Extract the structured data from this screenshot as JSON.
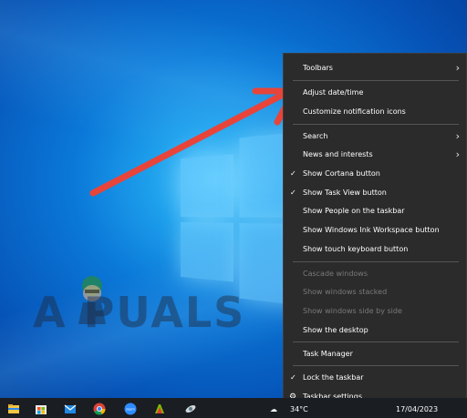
{
  "watermark": "A  PUALS",
  "context_menu": {
    "items": [
      {
        "label": "Toolbars",
        "submenu": true
      },
      {
        "label": "Adjust date/time"
      },
      {
        "label": "Customize notification icons"
      },
      {
        "label": "Search",
        "submenu": true
      },
      {
        "label": "News and interests",
        "submenu": true
      },
      {
        "label": "Show Cortana button",
        "checked": true
      },
      {
        "label": "Show Task View button",
        "checked": true
      },
      {
        "label": "Show People on the taskbar"
      },
      {
        "label": "Show Windows Ink Workspace button"
      },
      {
        "label": "Show touch keyboard button"
      },
      {
        "label": "Cascade windows",
        "disabled": true
      },
      {
        "label": "Show windows stacked",
        "disabled": true
      },
      {
        "label": "Show windows side by side",
        "disabled": true
      },
      {
        "label": "Show the desktop"
      },
      {
        "label": "Task Manager"
      },
      {
        "label": "Lock the taskbar",
        "checked": true
      },
      {
        "label": "Taskbar settings",
        "icon": "gear-icon"
      }
    ]
  },
  "taskbar": {
    "apps": [
      "file-explorer-icon",
      "microsoft-store-icon",
      "mail-icon",
      "chrome-icon",
      "zoom-icon",
      "snip-icon",
      "satellite-icon"
    ],
    "zoom_label": "zoom",
    "weather": "34°C",
    "date": "17/04/2023"
  },
  "colors": {
    "menu_bg": "#2b2b2b",
    "arrow": "#e8443a",
    "taskbar_bg": "#1a1d22"
  }
}
